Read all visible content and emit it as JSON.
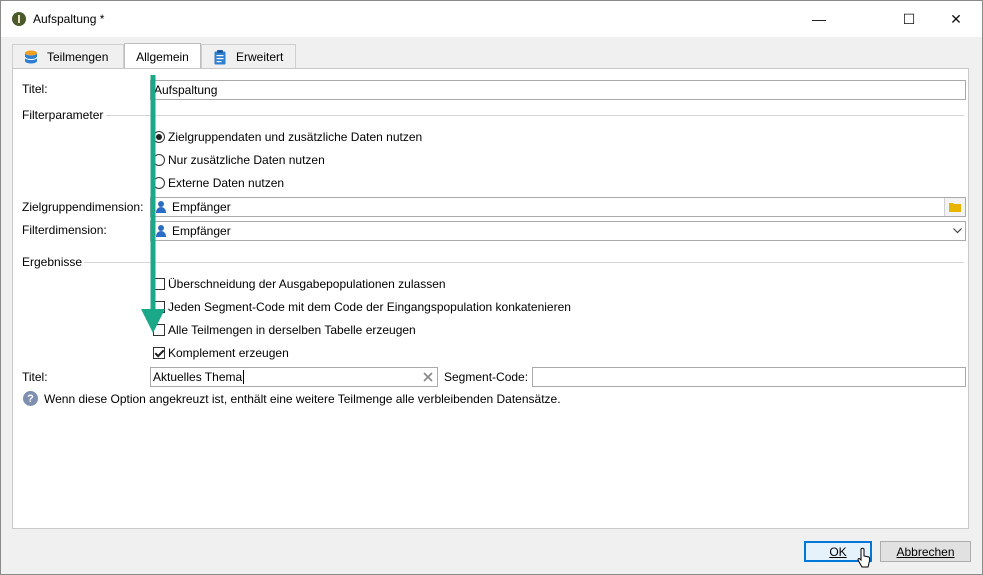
{
  "window": {
    "title": "Aufspaltung *",
    "minimize": "—",
    "maximize": "☐",
    "close": "✕"
  },
  "tabs": [
    {
      "label": "Teilmengen",
      "icon": "database-icon",
      "active": false
    },
    {
      "label": "Allgemein",
      "icon": "",
      "active": true
    },
    {
      "label": "Erweitert",
      "icon": "clipboard-icon",
      "active": false
    }
  ],
  "general": {
    "title_label": "Titel:",
    "title_value": "Aufspaltung",
    "filter_section": "Filterparameter",
    "radio_options": [
      {
        "label": "Zielgruppendaten und zusätzliche Daten nutzen",
        "checked": true
      },
      {
        "label": "Nur zusätzliche Daten nutzen",
        "checked": false
      },
      {
        "label": "Externe Daten nutzen",
        "checked": false
      }
    ],
    "target_dim_label": "Zielgruppendimension:",
    "target_dim_value": "Empfänger",
    "filter_dim_label": "Filterdimension:",
    "filter_dim_value": "Empfänger",
    "results_section": "Ergebnisse",
    "checkboxes": [
      {
        "label": "Überschneidung der Ausgabepopulationen zulassen",
        "checked": false
      },
      {
        "label": "Jeden Segment-Code mit dem Code der Eingangspopulation konkatenieren",
        "checked": false
      },
      {
        "label": "Alle Teilmengen in derselben Tabelle erzeugen",
        "checked": false
      },
      {
        "label": "Komplement erzeugen",
        "checked": true
      }
    ],
    "complement_title_label": "Titel:",
    "complement_title_value": "Aktuelles Thema",
    "segment_code_label": "Segment-Code:",
    "segment_code_value": "",
    "help_text": "Wenn diese Option angekreuzt ist, enthält eine weitere Teilmenge alle verbleibenden Datensätze."
  },
  "footer": {
    "ok": "OK",
    "cancel": "Abbrechen"
  },
  "colors": {
    "annotation_arrow": "#1aa889",
    "accent": "#0078d7",
    "folder": "#e8b400"
  }
}
